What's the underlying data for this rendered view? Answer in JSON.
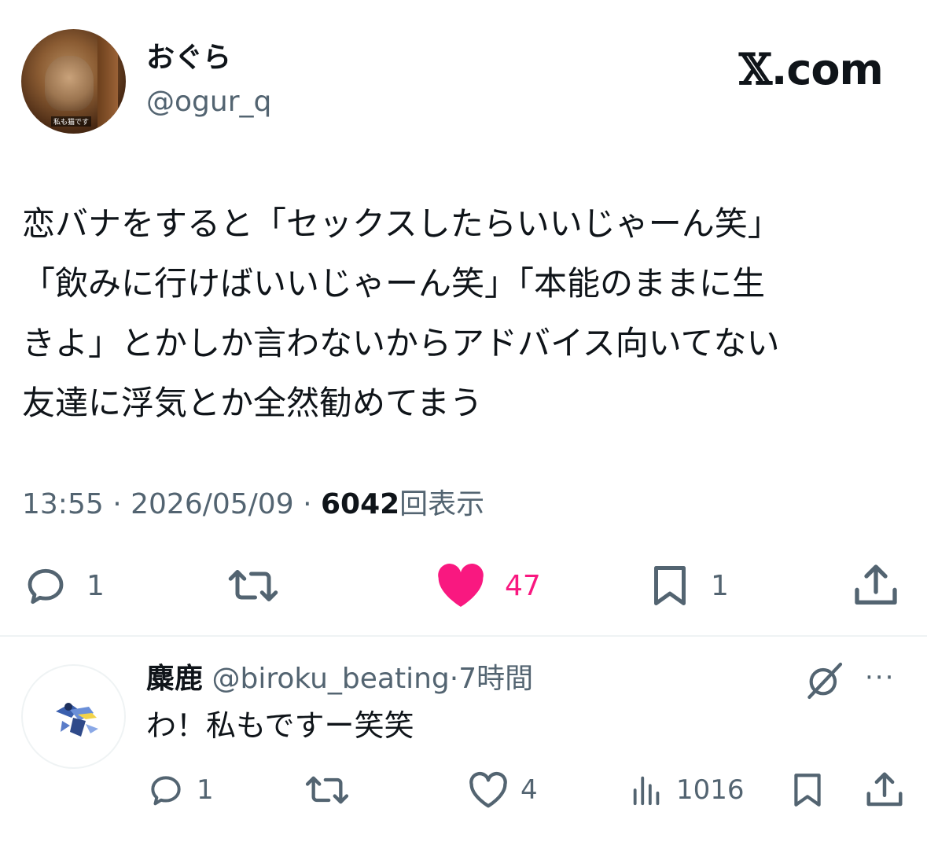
{
  "tweet": {
    "display_name": "おぐら",
    "handle": "@ogur_q",
    "avatar_caption": "私も猫です",
    "brand": "X.com",
    "text": "恋バナをすると「セックスしたらいいじゃーん笑」\n「飲みに行けばいいじゃーん笑」「本能のままに生\nきよ」とかしか言わないからアドバイス向いてない\n友達に浮気とか全然勧めてまう",
    "time": "13:55",
    "date": "2026/05/09",
    "views": "6042",
    "views_label": "回表示",
    "sep": "·",
    "actions": {
      "reply_count": "1",
      "retweet_count": "",
      "like_count": "47",
      "bookmark_count": "1"
    },
    "icons": [
      "reply-icon",
      "retweet-icon",
      "heart-filled-icon",
      "bookmark-icon",
      "share-icon"
    ],
    "colors": {
      "like": "#f91880",
      "secondary": "#536471",
      "text": "#0f1419"
    }
  },
  "reply": {
    "display_name": "麋鹿",
    "handle": "@biroku_beating",
    "time": "7時間",
    "sep": "·",
    "more": "···",
    "text": "わ！私もですー笑笑",
    "actions": {
      "reply_count": "1",
      "retweet_count": "",
      "like_count": "4",
      "views_count": "1016"
    },
    "icons": [
      "reply-icon",
      "retweet-icon",
      "heart-icon",
      "analytics-icon",
      "bookmark-icon",
      "share-icon",
      "grok-icon",
      "more-icon"
    ]
  }
}
